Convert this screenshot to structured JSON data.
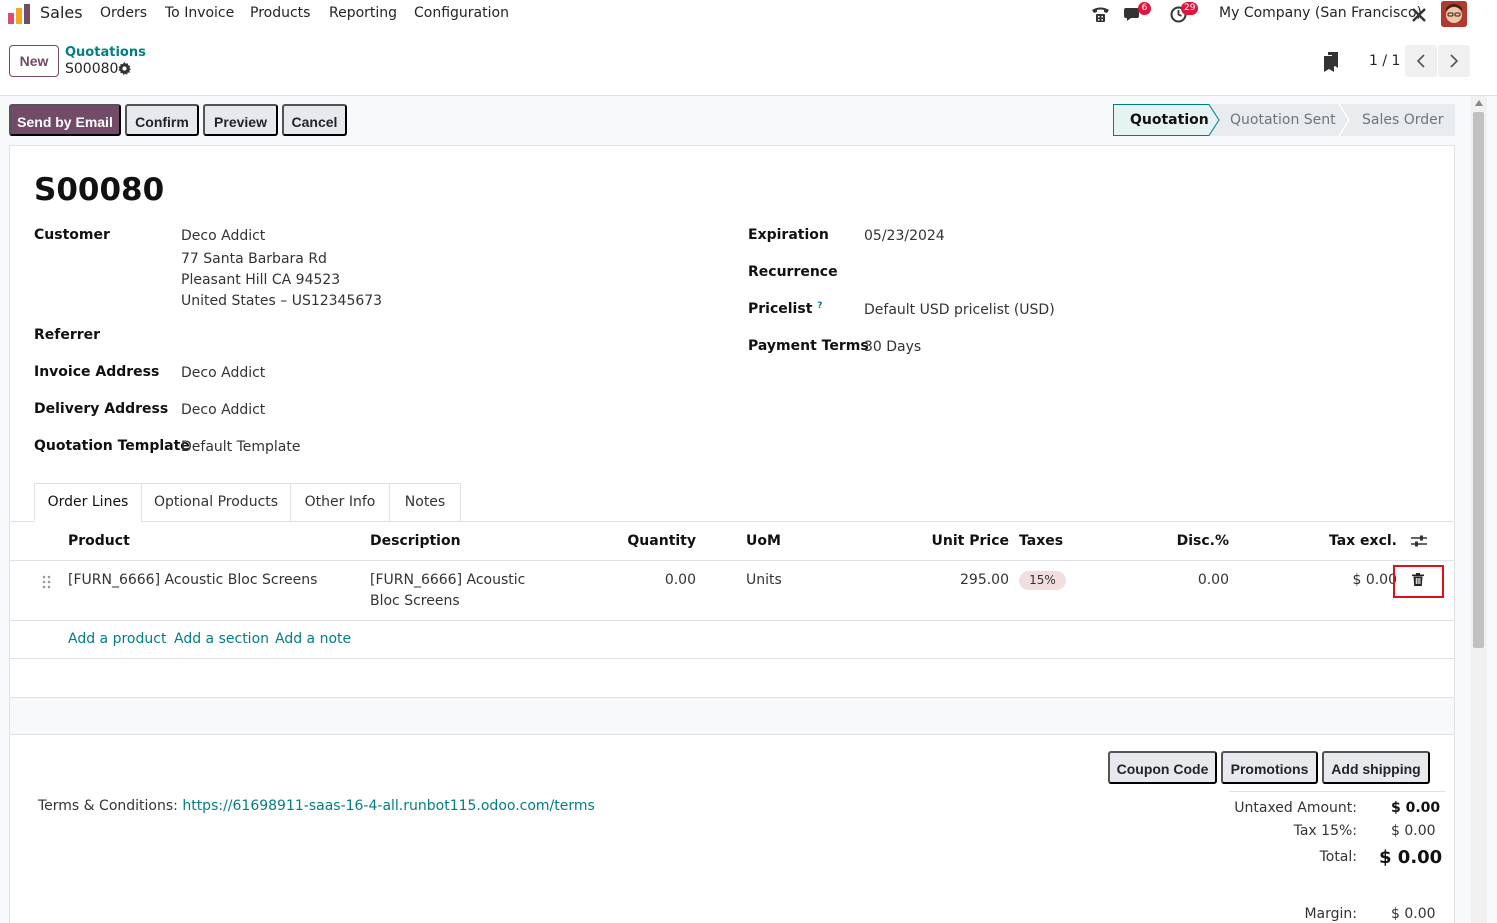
{
  "nav": {
    "app_name": "Sales",
    "menu": [
      "Orders",
      "To Invoice",
      "Products",
      "Reporting",
      "Configuration"
    ],
    "messages_badge": "6",
    "activities_badge": "29",
    "company": "My Company (San Francisco)"
  },
  "control": {
    "new_label": "New",
    "breadcrumb_parent": "Quotations",
    "breadcrumb_current": "S00080",
    "pager": "1 / 1"
  },
  "actions": {
    "send_email": "Send by Email",
    "confirm": "Confirm",
    "preview": "Preview",
    "cancel": "Cancel"
  },
  "statusbar": [
    "Quotation",
    "Quotation Sent",
    "Sales Order"
  ],
  "record": {
    "title": "S00080",
    "customer_label": "Customer",
    "customer_lines": [
      "Deco Addict",
      "77 Santa Barbara Rd",
      "Pleasant Hill CA 94523",
      "United States – US12345673"
    ],
    "referrer_label": "Referrer",
    "invoice_label": "Invoice Address",
    "invoice_value": "Deco Addict",
    "delivery_label": "Delivery Address",
    "delivery_value": "Deco Addict",
    "template_label": "Quotation Template",
    "template_value": "Default Template",
    "expiration_label": "Expiration",
    "expiration_value": "05/23/2024",
    "recurrence_label": "Recurrence",
    "pricelist_label": "Pricelist",
    "pricelist_hint": "?",
    "pricelist_value": "Default USD pricelist (USD)",
    "payment_label": "Payment Terms",
    "payment_value": "30 Days"
  },
  "tabs": [
    "Order Lines",
    "Optional Products",
    "Other Info",
    "Notes"
  ],
  "table": {
    "headers": {
      "product": "Product",
      "description": "Description",
      "quantity": "Quantity",
      "uom": "UoM",
      "unit_price": "Unit Price",
      "taxes": "Taxes",
      "discount": "Disc.%",
      "tax_excl": "Tax excl."
    },
    "rows": [
      {
        "product": "[FURN_6666] Acoustic Bloc Screens",
        "description_1": "[FURN_6666] Acoustic",
        "description_2": "Bloc Screens",
        "quantity": "0.00",
        "uom": "Units",
        "unit_price": "295.00",
        "tax": "15%",
        "discount": "0.00",
        "subtotal": "$ 0.00"
      }
    ],
    "add_product": "Add a product",
    "add_section": "Add a section",
    "add_note": "Add a note"
  },
  "buttons": {
    "coupon": "Coupon Code",
    "promotions": "Promotions",
    "shipping": "Add shipping"
  },
  "terms": {
    "label": "Terms & Conditions: ",
    "link": "https://61698911-saas-16-4-all.runbot115.odoo.com/terms"
  },
  "totals": {
    "untaxed_label": "Untaxed Amount:",
    "untaxed_value": "$ 0.00",
    "tax_label": "Tax 15%:",
    "tax_value": "$ 0.00",
    "total_label": "Total:",
    "total_value": "$ 0.00",
    "margin_label": "Margin:",
    "margin_value": "$ 0.00"
  },
  "colors": {
    "primary": "#714b67",
    "link": "#017e84",
    "highlight": "#e0101b"
  }
}
